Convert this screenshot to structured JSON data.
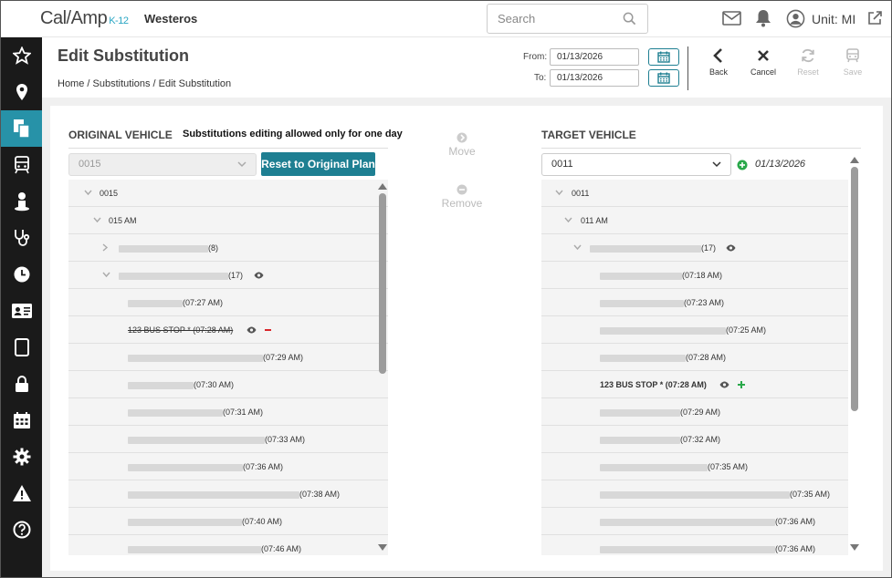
{
  "brand": {
    "logo": "Cal/Amp",
    "logo_sub": "K-12",
    "org": "Westeros"
  },
  "search": {
    "placeholder": "Search"
  },
  "user": {
    "unit_label": "Unit: MI"
  },
  "sidebar": {
    "items": [
      {
        "icon": "star-icon"
      },
      {
        "icon": "map-pin-icon"
      },
      {
        "icon": "documents-icon",
        "active": true
      },
      {
        "icon": "bus-icon"
      },
      {
        "icon": "student-icon"
      },
      {
        "icon": "stethoscope-icon"
      },
      {
        "icon": "clock-icon"
      },
      {
        "icon": "id-card-icon"
      },
      {
        "icon": "tablet-icon"
      },
      {
        "icon": "lock-icon"
      },
      {
        "icon": "calendar-icon"
      },
      {
        "icon": "gear-icon"
      },
      {
        "icon": "warning-icon"
      },
      {
        "icon": "help-icon"
      }
    ]
  },
  "page": {
    "title": "Edit Substitution",
    "breadcrumb": "Home / Substitutions / Edit Substitution"
  },
  "dates": {
    "from_label": "From:",
    "from_value": "01/13/2026",
    "to_label": "To:",
    "to_value": "01/13/2026"
  },
  "toolbar": {
    "back": "Back",
    "cancel": "Cancel",
    "reset": "Reset",
    "save": "Save"
  },
  "original": {
    "heading": "ORIGINAL VEHICLE",
    "note": "Substitutions editing allowed only for one day",
    "selected": "0015",
    "reset_label": "Reset to Original Plan",
    "rows": [
      {
        "text": "0015"
      },
      {
        "text": "015 AM"
      },
      {
        "text": "(8)"
      },
      {
        "text": "(17)"
      },
      {
        "text": "(07:27 AM)"
      },
      {
        "text": "123 BUS STOP * (07:28 AM)"
      },
      {
        "text": "(07:29 AM)"
      },
      {
        "text": "(07:30 AM)"
      },
      {
        "text": "(07:31 AM)"
      },
      {
        "text": "(07:33 AM)"
      },
      {
        "text": "(07:36 AM)"
      },
      {
        "text": "(07:38 AM)"
      },
      {
        "text": "(07:40 AM)"
      },
      {
        "text": "(07:46 AM)"
      }
    ]
  },
  "middle": {
    "move": "Move",
    "remove": "Remove"
  },
  "target": {
    "heading": "TARGET VEHICLE",
    "selected": "0011",
    "date": "01/13/2026",
    "rows": [
      {
        "text": "0011"
      },
      {
        "text": "011 AM"
      },
      {
        "text": "(17)"
      },
      {
        "text": "(07:18 AM)"
      },
      {
        "text": "(07:23 AM)"
      },
      {
        "text": "(07:25 AM)"
      },
      {
        "text": "(07:28 AM)"
      },
      {
        "text": "123 BUS STOP * (07:28 AM)"
      },
      {
        "text": "(07:29 AM)"
      },
      {
        "text": "(07:32 AM)"
      },
      {
        "text": "(07:35 AM)"
      },
      {
        "text": "(07:35 AM)"
      },
      {
        "text": "(07:36 AM)"
      },
      {
        "text": "(07:36 AM)"
      }
    ]
  },
  "colors": {
    "accent": "#1e7f92",
    "sidebar_bg": "#1a1a1a",
    "sidebar_active": "#2792a8",
    "remove_red": "#d9262a",
    "add_green": "#2aa84a"
  }
}
